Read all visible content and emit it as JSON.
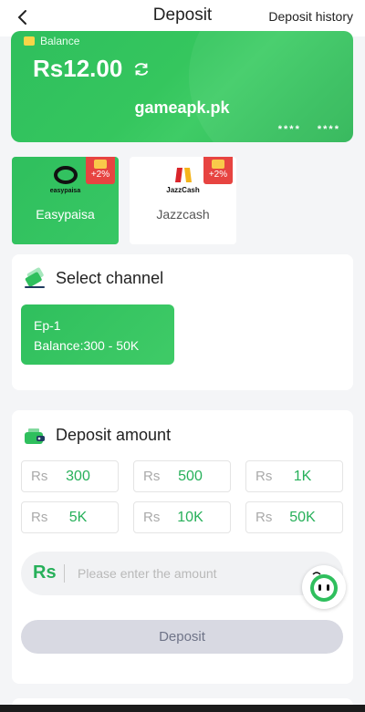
{
  "header": {
    "title": "Deposit",
    "history_label": "Deposit history"
  },
  "balance_card": {
    "label": "Balance",
    "amount": "Rs12.00",
    "site": "gameapk.pk",
    "card_mask": [
      "****",
      "****"
    ]
  },
  "payment_methods": [
    {
      "name": "Easypaisa",
      "logo_text": "easypaisa",
      "badge": "+2%",
      "selected": true
    },
    {
      "name": "Jazzcash",
      "logo_text": "JazzCash",
      "badge": "+2%",
      "selected": false
    }
  ],
  "channel": {
    "title": "Select channel",
    "option": {
      "name": "Ep-1",
      "range": "Balance:300 - 50K"
    }
  },
  "deposit_amount": {
    "title": "Deposit amount",
    "currency": "Rs",
    "presets": [
      "300",
      "500",
      "1K",
      "5K",
      "10K",
      "50K"
    ],
    "input_placeholder": "Please enter the amount",
    "input_value": "",
    "submit_label": "Deposit"
  },
  "colors": {
    "accent": "#2fbf5d",
    "badge": "#e74441",
    "button_disabled": "#d8d9e2"
  },
  "icons": {
    "back": "chevron-left-icon",
    "refresh": "refresh-icon",
    "channel": "card-icon",
    "amount": "wallet-icon",
    "support": "chat-support-icon"
  }
}
